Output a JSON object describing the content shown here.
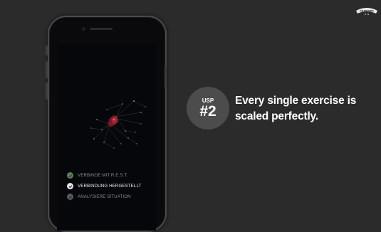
{
  "usp": {
    "label": "USP",
    "number": "#2"
  },
  "headline": {
    "line1": "Every single exercise is",
    "line2": "scaled perfectly."
  },
  "status_items": [
    {
      "text": "VERBINDE MIT R.E.S.T.",
      "state": "done"
    },
    {
      "text": "VERBINDUNG HERGESTELLT",
      "state": "active"
    },
    {
      "text": "ANALYSIERE SITUATION",
      "state": "pending"
    }
  ],
  "logo": {
    "text": "GEARWIRE"
  },
  "colors": {
    "background": "#2b2b2b",
    "badge": "#4c4c4c",
    "check_done": "#5f7f5a",
    "check_active": "#e6e6e6",
    "check_pending": "#5a5a5a",
    "network_core": "#c0263a"
  }
}
